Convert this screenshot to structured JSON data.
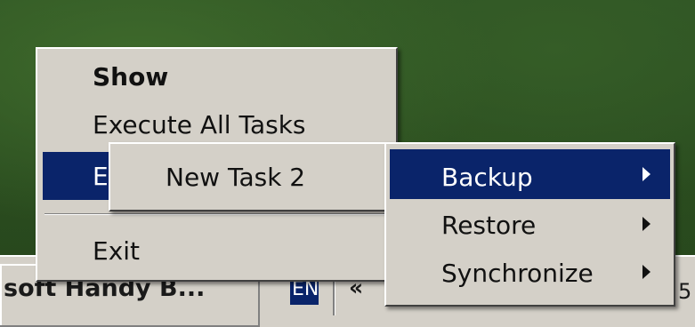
{
  "taskbar": {
    "task_button_label": "soft Handy B...",
    "lang_label": "EN",
    "tray_chevron": "«",
    "tray_digit": "5"
  },
  "main_menu": {
    "show_label": "Show",
    "execute_all_label": "Execute All Tasks",
    "execute_partial_label": "E",
    "exit_label": "Exit"
  },
  "task_submenu": {
    "task_label": "New Task 2"
  },
  "action_submenu": {
    "backup_label": "Backup",
    "restore_label": "Restore",
    "synchronize_label": "Synchronize"
  },
  "colors": {
    "highlight": "#0a246a",
    "menu_face": "#d4d0c8"
  },
  "icons": [
    "submenu-arrow-icon"
  ]
}
